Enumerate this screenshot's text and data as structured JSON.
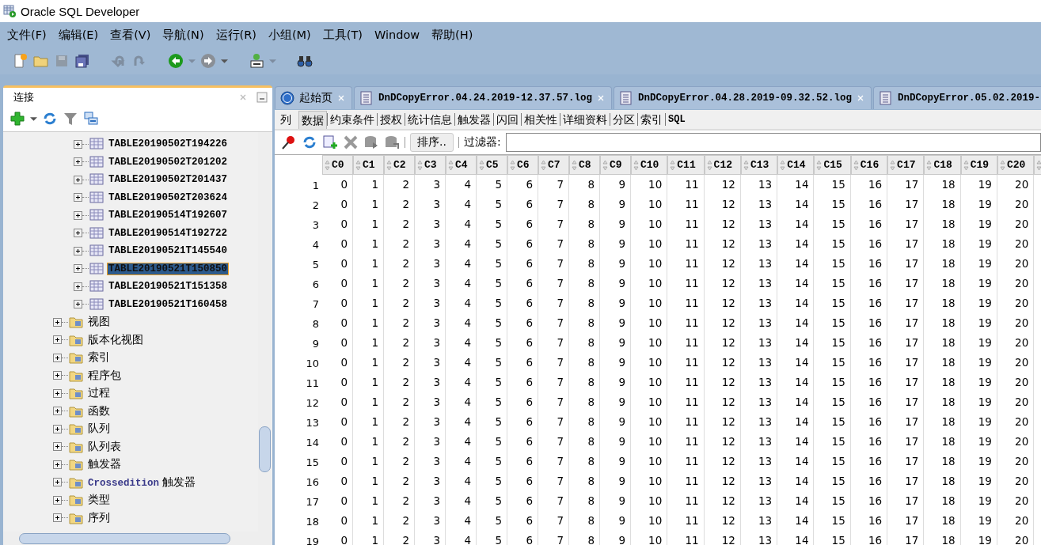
{
  "window": {
    "title": "Oracle SQL Developer"
  },
  "menu": [
    "文件(F)",
    "编辑(E)",
    "查看(V)",
    "导航(N)",
    "运行(R)",
    "小组(M)",
    "工具(T)",
    "Window",
    "帮助(H)"
  ],
  "connections": {
    "title": "连接",
    "tree": [
      {
        "kind": "table",
        "label": "TABLE20190502T194226",
        "selected": false
      },
      {
        "kind": "table",
        "label": "TABLE20190502T201202",
        "selected": false
      },
      {
        "kind": "table",
        "label": "TABLE20190502T201437",
        "selected": false
      },
      {
        "kind": "table",
        "label": "TABLE20190502T203624",
        "selected": false
      },
      {
        "kind": "table",
        "label": "TABLE20190514T192607",
        "selected": false
      },
      {
        "kind": "table",
        "label": "TABLE20190514T192722",
        "selected": false
      },
      {
        "kind": "table",
        "label": "TABLE20190521T145540",
        "selected": false
      },
      {
        "kind": "table",
        "label": "TABLE20190521T150850",
        "selected": true
      },
      {
        "kind": "table",
        "label": "TABLE20190521T151358",
        "selected": false
      },
      {
        "kind": "table",
        "label": "TABLE20190521T160458",
        "selected": false
      },
      {
        "kind": "folder",
        "label": "视图",
        "selected": false
      },
      {
        "kind": "folder",
        "label": "版本化视图",
        "selected": false
      },
      {
        "kind": "folder",
        "label": "索引",
        "selected": false
      },
      {
        "kind": "folder",
        "label": "程序包",
        "selected": false
      },
      {
        "kind": "folder",
        "label": "过程",
        "selected": false
      },
      {
        "kind": "folder",
        "label": "函数",
        "selected": false
      },
      {
        "kind": "folder",
        "label": "队列",
        "selected": false
      },
      {
        "kind": "folder",
        "label": "队列表",
        "selected": false
      },
      {
        "kind": "folder",
        "label": "触发器",
        "selected": false
      },
      {
        "kind": "folder",
        "label": "Crossedition",
        "label2": "触发器",
        "selected": false
      },
      {
        "kind": "folder",
        "label": "类型",
        "selected": false
      },
      {
        "kind": "folder",
        "label": "序列",
        "selected": false
      }
    ]
  },
  "editor_tabs": [
    {
      "kind": "start",
      "label": "起始页",
      "selected": false
    },
    {
      "kind": "log",
      "label": "DnDCopyError.04.24.2019-12.37.57.log",
      "selected": false
    },
    {
      "kind": "log",
      "label": "DnDCopyError.04.28.2019-09.32.52.log",
      "selected": false
    },
    {
      "kind": "log",
      "label": "DnDCopyError.05.02.2019-",
      "selected": false
    }
  ],
  "sub_tabs": [
    {
      "label": "列",
      "selected": false
    },
    {
      "label": "数据",
      "selected": true
    },
    {
      "label": "约束条件",
      "selected": false
    },
    {
      "label": "授权",
      "selected": false
    },
    {
      "label": "统计信息",
      "selected": false
    },
    {
      "label": "触发器",
      "selected": false
    },
    {
      "label": "闪回",
      "selected": false
    },
    {
      "label": "相关性",
      "selected": false
    },
    {
      "label": "详细资料",
      "selected": false
    },
    {
      "label": "分区",
      "selected": false
    },
    {
      "label": "索引",
      "selected": false
    },
    {
      "label": "SQL",
      "selected": false
    }
  ],
  "data_toolbar": {
    "sort_button": "排序..",
    "filter_label": "过滤器:"
  },
  "table": {
    "columns": [
      "C0",
      "C1",
      "C2",
      "C3",
      "C4",
      "C5",
      "C6",
      "C7",
      "C8",
      "C9",
      "C10",
      "C11",
      "C12",
      "C13",
      "C14",
      "C15",
      "C16",
      "C17",
      "C18",
      "C19",
      "C20"
    ],
    "rows": [
      {
        "num": "1",
        "cells": [
          "0",
          "1",
          "2",
          "3",
          "4",
          "5",
          "6",
          "7",
          "8",
          "9",
          "10",
          "11",
          "12",
          "13",
          "14",
          "15",
          "16",
          "17",
          "18",
          "19",
          "20"
        ]
      },
      {
        "num": "2",
        "cells": [
          "0",
          "1",
          "2",
          "3",
          "4",
          "5",
          "6",
          "7",
          "8",
          "9",
          "10",
          "11",
          "12",
          "13",
          "14",
          "15",
          "16",
          "17",
          "18",
          "19",
          "20"
        ]
      },
      {
        "num": "3",
        "cells": [
          "0",
          "1",
          "2",
          "3",
          "4",
          "5",
          "6",
          "7",
          "8",
          "9",
          "10",
          "11",
          "12",
          "13",
          "14",
          "15",
          "16",
          "17",
          "18",
          "19",
          "20"
        ]
      },
      {
        "num": "4",
        "cells": [
          "0",
          "1",
          "2",
          "3",
          "4",
          "5",
          "6",
          "7",
          "8",
          "9",
          "10",
          "11",
          "12",
          "13",
          "14",
          "15",
          "16",
          "17",
          "18",
          "19",
          "20"
        ]
      },
      {
        "num": "5",
        "cells": [
          "0",
          "1",
          "2",
          "3",
          "4",
          "5",
          "6",
          "7",
          "8",
          "9",
          "10",
          "11",
          "12",
          "13",
          "14",
          "15",
          "16",
          "17",
          "18",
          "19",
          "20"
        ]
      },
      {
        "num": "6",
        "cells": [
          "0",
          "1",
          "2",
          "3",
          "4",
          "5",
          "6",
          "7",
          "8",
          "9",
          "10",
          "11",
          "12",
          "13",
          "14",
          "15",
          "16",
          "17",
          "18",
          "19",
          "20"
        ]
      },
      {
        "num": "7",
        "cells": [
          "0",
          "1",
          "2",
          "3",
          "4",
          "5",
          "6",
          "7",
          "8",
          "9",
          "10",
          "11",
          "12",
          "13",
          "14",
          "15",
          "16",
          "17",
          "18",
          "19",
          "20"
        ]
      },
      {
        "num": "8",
        "cells": [
          "0",
          "1",
          "2",
          "3",
          "4",
          "5",
          "6",
          "7",
          "8",
          "9",
          "10",
          "11",
          "12",
          "13",
          "14",
          "15",
          "16",
          "17",
          "18",
          "19",
          "20"
        ]
      },
      {
        "num": "9",
        "cells": [
          "0",
          "1",
          "2",
          "3",
          "4",
          "5",
          "6",
          "7",
          "8",
          "9",
          "10",
          "11",
          "12",
          "13",
          "14",
          "15",
          "16",
          "17",
          "18",
          "19",
          "20"
        ]
      },
      {
        "num": "10",
        "cells": [
          "0",
          "1",
          "2",
          "3",
          "4",
          "5",
          "6",
          "7",
          "8",
          "9",
          "10",
          "11",
          "12",
          "13",
          "14",
          "15",
          "16",
          "17",
          "18",
          "19",
          "20"
        ]
      },
      {
        "num": "11",
        "cells": [
          "0",
          "1",
          "2",
          "3",
          "4",
          "5",
          "6",
          "7",
          "8",
          "9",
          "10",
          "11",
          "12",
          "13",
          "14",
          "15",
          "16",
          "17",
          "18",
          "19",
          "20"
        ]
      },
      {
        "num": "12",
        "cells": [
          "0",
          "1",
          "2",
          "3",
          "4",
          "5",
          "6",
          "7",
          "8",
          "9",
          "10",
          "11",
          "12",
          "13",
          "14",
          "15",
          "16",
          "17",
          "18",
          "19",
          "20"
        ]
      },
      {
        "num": "13",
        "cells": [
          "0",
          "1",
          "2",
          "3",
          "4",
          "5",
          "6",
          "7",
          "8",
          "9",
          "10",
          "11",
          "12",
          "13",
          "14",
          "15",
          "16",
          "17",
          "18",
          "19",
          "20"
        ]
      },
      {
        "num": "14",
        "cells": [
          "0",
          "1",
          "2",
          "3",
          "4",
          "5",
          "6",
          "7",
          "8",
          "9",
          "10",
          "11",
          "12",
          "13",
          "14",
          "15",
          "16",
          "17",
          "18",
          "19",
          "20"
        ]
      },
      {
        "num": "15",
        "cells": [
          "0",
          "1",
          "2",
          "3",
          "4",
          "5",
          "6",
          "7",
          "8",
          "9",
          "10",
          "11",
          "12",
          "13",
          "14",
          "15",
          "16",
          "17",
          "18",
          "19",
          "20"
        ]
      },
      {
        "num": "16",
        "cells": [
          "0",
          "1",
          "2",
          "3",
          "4",
          "5",
          "6",
          "7",
          "8",
          "9",
          "10",
          "11",
          "12",
          "13",
          "14",
          "15",
          "16",
          "17",
          "18",
          "19",
          "20"
        ]
      },
      {
        "num": "17",
        "cells": [
          "0",
          "1",
          "2",
          "3",
          "4",
          "5",
          "6",
          "7",
          "8",
          "9",
          "10",
          "11",
          "12",
          "13",
          "14",
          "15",
          "16",
          "17",
          "18",
          "19",
          "20"
        ]
      },
      {
        "num": "18",
        "cells": [
          "0",
          "1",
          "2",
          "3",
          "4",
          "5",
          "6",
          "7",
          "8",
          "9",
          "10",
          "11",
          "12",
          "13",
          "14",
          "15",
          "16",
          "17",
          "18",
          "19",
          "20"
        ]
      },
      {
        "num": "19",
        "cells": [
          "0",
          "1",
          "2",
          "3",
          "4",
          "5",
          "6",
          "7",
          "8",
          "9",
          "10",
          "11",
          "12",
          "13",
          "14",
          "15",
          "16",
          "17",
          "18",
          "19",
          "20"
        ]
      }
    ]
  }
}
